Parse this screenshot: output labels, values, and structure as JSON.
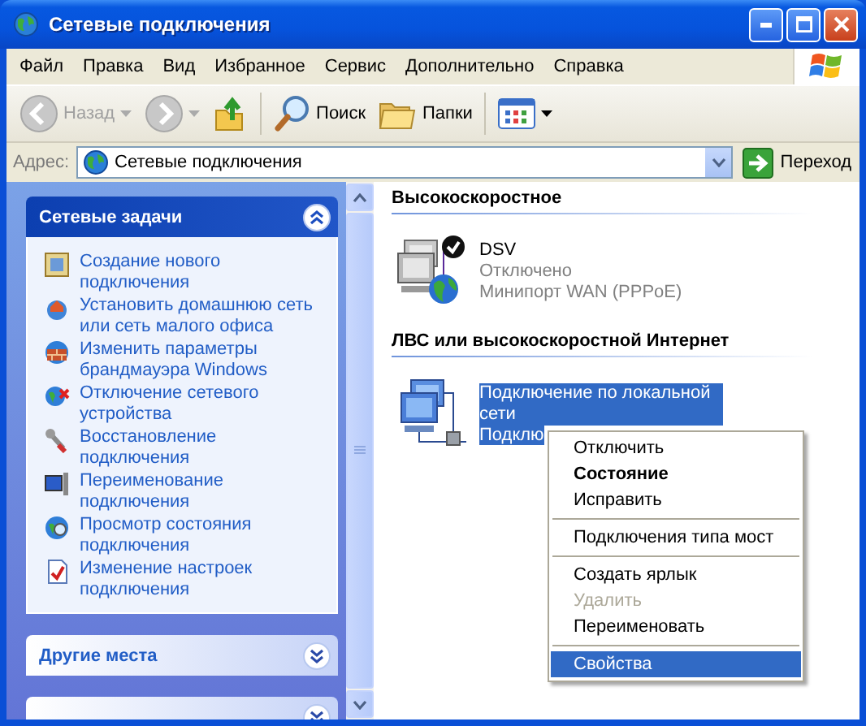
{
  "window": {
    "title": "Сетевые подключения"
  },
  "menu_bar": [
    "Файл",
    "Правка",
    "Вид",
    "Избранное",
    "Сервис",
    "Дополнительно",
    "Справка"
  ],
  "toolbar": [
    {
      "kind": "back",
      "label": "Назад",
      "disabled": true
    },
    {
      "kind": "forward",
      "disabled": true
    },
    {
      "kind": "up",
      "disabled": false
    },
    {
      "kind": "search",
      "label": "Поиск",
      "disabled": false
    },
    {
      "kind": "folders",
      "label": "Папки",
      "disabled": false
    },
    {
      "kind": "views",
      "disabled": false
    }
  ],
  "address_bar": {
    "label": "Адрес:",
    "value": "Сетевые подключения",
    "go_button": "Переход"
  },
  "task_pane": {
    "panels": [
      {
        "title": "Сетевые задачи",
        "expanded": true,
        "links": [
          "Создание нового подключения",
          "Установить домашнюю сеть или сеть малого офиса",
          "Изменить параметры брандмауэра Windows",
          "Отключение сетевого устройства",
          "Восстановление подключения",
          "Переименование подключения",
          "Просмотр состояния подключения",
          "Изменение настроек подключения"
        ]
      },
      {
        "title": "Другие места",
        "expanded": false
      },
      {
        "expanded": false
      }
    ]
  },
  "content": {
    "groups": [
      {
        "title": "Высокоскоростное",
        "items": [
          {
            "kind": "dialup",
            "name": "DSV",
            "status": "Отключено",
            "device": "Минипорт WAN (PPPoE)",
            "selected": false
          }
        ]
      },
      {
        "title": "ЛВС или высокоскоростной Интернет",
        "items": [
          {
            "kind": "lan",
            "name": "Подключение по локальной сети",
            "status": "Подклю",
            "selected": true
          }
        ]
      }
    ]
  },
  "context_menu": {
    "items": [
      {
        "kind": "item",
        "label": "Отключить",
        "default": false,
        "disabled": false,
        "selected": false
      },
      {
        "kind": "item",
        "label": "Состояние",
        "default": true,
        "disabled": false,
        "selected": false
      },
      {
        "kind": "item",
        "label": "Исправить",
        "default": false,
        "disabled": false,
        "selected": false
      },
      {
        "kind": "separator"
      },
      {
        "kind": "item",
        "label": "Подключения типа мост",
        "default": false,
        "disabled": false,
        "selected": false
      },
      {
        "kind": "separator"
      },
      {
        "kind": "item",
        "label": "Создать ярлык",
        "default": false,
        "disabled": false,
        "selected": false
      },
      {
        "kind": "item",
        "label": "Удалить",
        "default": false,
        "disabled": true,
        "selected": false
      },
      {
        "kind": "item",
        "label": "Переименовать",
        "default": false,
        "disabled": false,
        "selected": false
      },
      {
        "kind": "separator"
      },
      {
        "kind": "item",
        "label": "Свойства",
        "default": false,
        "disabled": false,
        "selected": true
      }
    ]
  }
}
